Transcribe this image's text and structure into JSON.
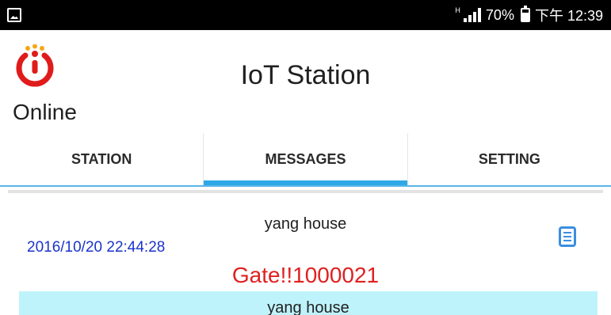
{
  "status_bar": {
    "network_label": "H",
    "battery_percent": "70%",
    "time": "下午 12:39"
  },
  "header": {
    "title": "IoT Station",
    "connection_status": "Online",
    "logo_icon": "power-logo-icon",
    "logo_color": "#e01b1b",
    "logo_dot_color": "#f2a818"
  },
  "tabs": [
    {
      "label": "STATION",
      "active": false
    },
    {
      "label": "MESSAGES",
      "active": true
    },
    {
      "label": "SETTING",
      "active": false
    }
  ],
  "messages": [
    {
      "sender": "yang house",
      "timestamp": "2016/10/20 22:44:28",
      "body": "Gate!!1000021",
      "icon": "document-list-icon"
    }
  ],
  "next_message": {
    "sender": "yang house"
  },
  "colors": {
    "tab_indicator": "#2ea8e6",
    "timestamp": "#1a33cc",
    "message_body": "#e02020",
    "next_card_bg": "#bff3fb"
  }
}
